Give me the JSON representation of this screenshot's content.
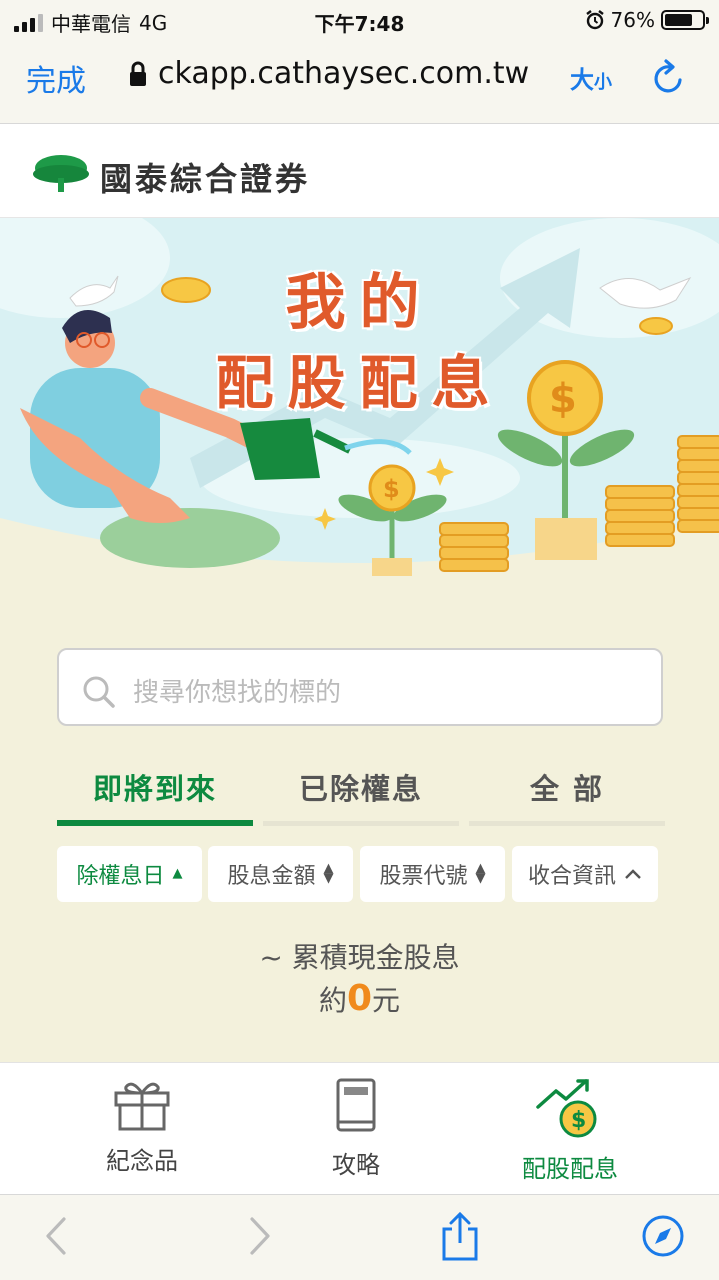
{
  "status_bar": {
    "carrier": "中華電信",
    "network": "4G",
    "time": "下午7:48",
    "battery_percent": "76%",
    "battery_level": 0.76
  },
  "address_bar": {
    "done_label": "完成",
    "url": "ckapp.cathaysec.com.tw",
    "text_size_big": "大",
    "text_size_small": "小"
  },
  "header": {
    "brand_name": "國泰綜合證券"
  },
  "banner": {
    "title_line1": "我的",
    "title_line2": "配股配息"
  },
  "search": {
    "placeholder": "搜尋你想找的標的"
  },
  "tabs": [
    {
      "label": "即將到來",
      "active": true
    },
    {
      "label": "已除權息",
      "active": false
    },
    {
      "label": "全 部",
      "active": false
    }
  ],
  "filters": [
    {
      "label": "除權息日",
      "state": "asc",
      "active": true
    },
    {
      "label": "股息金額",
      "state": "sort",
      "active": false
    },
    {
      "label": "股票代號",
      "state": "sort",
      "active": false
    },
    {
      "label": "收合資訊",
      "state": "up",
      "active": false
    }
  ],
  "summary": {
    "label": "~ 累積現金股息",
    "prefix": "約",
    "amount": "0",
    "suffix": "元"
  },
  "bottom_nav": [
    {
      "label": "紀念品",
      "icon": "gift-icon"
    },
    {
      "label": "攻略",
      "icon": "book-icon"
    },
    {
      "label": "配股配息",
      "icon": "dividend-chart-icon",
      "active": true
    }
  ],
  "colors": {
    "brand_green": "#0d8a40",
    "ios_blue": "#1a7ae8",
    "accent_orange": "#f08a1c",
    "banner_red": "#e05a2b",
    "page_bg": "#f3f1dc"
  }
}
